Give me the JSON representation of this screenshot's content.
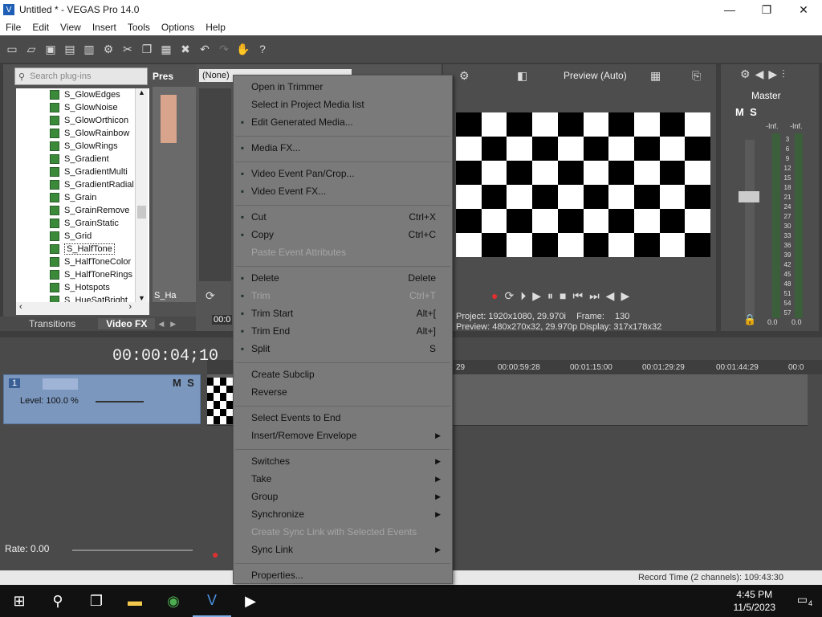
{
  "window": {
    "title": "Untitled * - VEGAS Pro 14.0",
    "controls": [
      "—",
      "❐",
      "✕"
    ]
  },
  "menubar": [
    "File",
    "Edit",
    "View",
    "Insert",
    "Tools",
    "Options",
    "Help"
  ],
  "plugins": {
    "search_placeholder": "Search plug-ins",
    "preview_label": "Pres",
    "preview_item": "S_Ha",
    "items": [
      "S_GlowEdges",
      "S_GlowNoise",
      "S_GlowOrthicon",
      "S_GlowRainbow",
      "S_GlowRings",
      "S_Gradient",
      "S_GradientMulti",
      "S_GradientRadial",
      "S_Grain",
      "S_GrainRemove",
      "S_GrainStatic",
      "S_Grid",
      "S_HalfTone",
      "S_HalfToneColor",
      "S_HalfToneRings",
      "S_Hotspots",
      "S_HueSatBright"
    ],
    "selected": "S_HalfTone",
    "tabs": [
      "Transitions",
      "Video FX"
    ]
  },
  "trimmer": {
    "dropdown": "(None)",
    "timecode": "00:0"
  },
  "video_preview": {
    "mode": "Preview (Auto)",
    "project_label": "Project:",
    "project_value": "1920x1080, 29.970i",
    "preview_label": "Preview:",
    "preview_value": "480x270x32, 29.970p",
    "frame_label": "Frame:",
    "frame_value": "130",
    "display_label": "Display:",
    "display_value": "317x178x32"
  },
  "master": {
    "label": "Master",
    "left_db": "-Inf.",
    "right_db": "-Inf.",
    "scale": [
      "3",
      "6",
      "9",
      "12",
      "15",
      "18",
      "21",
      "24",
      "27",
      "30",
      "33",
      "36",
      "39",
      "42",
      "45",
      "48",
      "51",
      "54",
      "57"
    ],
    "bottom_left": "0.0",
    "bottom_right": "0.0"
  },
  "timeline": {
    "timecode": "00:00:04;10",
    "track_number": "1",
    "level": "Level: 100.0 %",
    "ruler": [
      "29",
      "00:00:59:28",
      "00:01:15:00",
      "00:01:29:29",
      "00:01:44:29",
      "00:0"
    ],
    "rate": "Rate: 0.00"
  },
  "context_menu": [
    {
      "label": "Open in Trimmer"
    },
    {
      "label": "Select in Project Media list"
    },
    {
      "label": "Edit Generated Media...",
      "icon": "edit-media-icon"
    },
    {
      "sep": true
    },
    {
      "label": "Media FX...",
      "icon": "media-fx-icon"
    },
    {
      "sep": true
    },
    {
      "label": "Video Event Pan/Crop...",
      "icon": "pan-crop-icon"
    },
    {
      "label": "Video Event FX...",
      "icon": "event-fx-icon"
    },
    {
      "sep": true
    },
    {
      "label": "Cut",
      "shortcut": "Ctrl+X",
      "icon": "cut-icon"
    },
    {
      "label": "Copy",
      "shortcut": "Ctrl+C",
      "icon": "copy-icon"
    },
    {
      "label": "Paste Event Attributes",
      "disabled": true
    },
    {
      "sep": true
    },
    {
      "label": "Delete",
      "shortcut": "Delete",
      "icon": "delete-icon"
    },
    {
      "label": "Trim",
      "shortcut": "Ctrl+T",
      "disabled": true,
      "icon": "trim-icon"
    },
    {
      "label": "Trim Start",
      "shortcut": "Alt+[",
      "icon": "trim-start-icon"
    },
    {
      "label": "Trim End",
      "shortcut": "Alt+]",
      "icon": "trim-end-icon"
    },
    {
      "label": "Split",
      "shortcut": "S",
      "icon": "split-icon"
    },
    {
      "sep": true
    },
    {
      "label": "Create Subclip"
    },
    {
      "label": "Reverse"
    },
    {
      "sep": true
    },
    {
      "label": "Select Events to End"
    },
    {
      "label": "Insert/Remove Envelope",
      "submenu": true
    },
    {
      "sep": true
    },
    {
      "label": "Switches",
      "submenu": true
    },
    {
      "label": "Take",
      "submenu": true
    },
    {
      "label": "Group",
      "submenu": true
    },
    {
      "label": "Synchronize",
      "submenu": true
    },
    {
      "label": "Create Sync Link with Selected Events",
      "disabled": true
    },
    {
      "label": "Sync Link",
      "submenu": true
    },
    {
      "sep": true
    },
    {
      "label": "Properties..."
    }
  ],
  "statusbar": "Record Time (2 channels): 109:43:30",
  "taskbar": {
    "time": "4:45 PM",
    "date": "11/5/2023",
    "notifications": "4"
  }
}
